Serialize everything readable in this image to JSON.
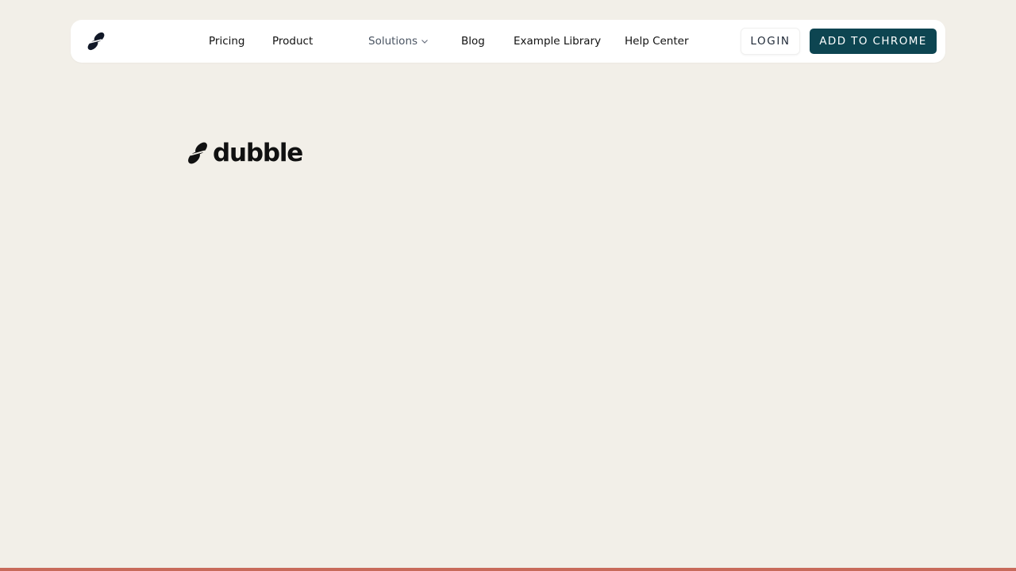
{
  "nav": {
    "logo_icon": "dubble-logo-icon",
    "links": {
      "pricing": "Pricing",
      "product": "Product",
      "solutions": "Solutions",
      "blog": "Blog",
      "example_library": "Example Library",
      "help_center": "Help Center"
    },
    "login_label": "LOGIN",
    "cta_label": "ADD TO CHROME"
  },
  "brand": {
    "icon": "dubble-logo-icon",
    "wordmark": "dubble"
  },
  "colors": {
    "background": "#f2efe8",
    "nav_background": "#ffffff",
    "cta_background": "#0d4551",
    "cta_text": "#ffffff",
    "bottom_accent": "#c86a5a"
  }
}
